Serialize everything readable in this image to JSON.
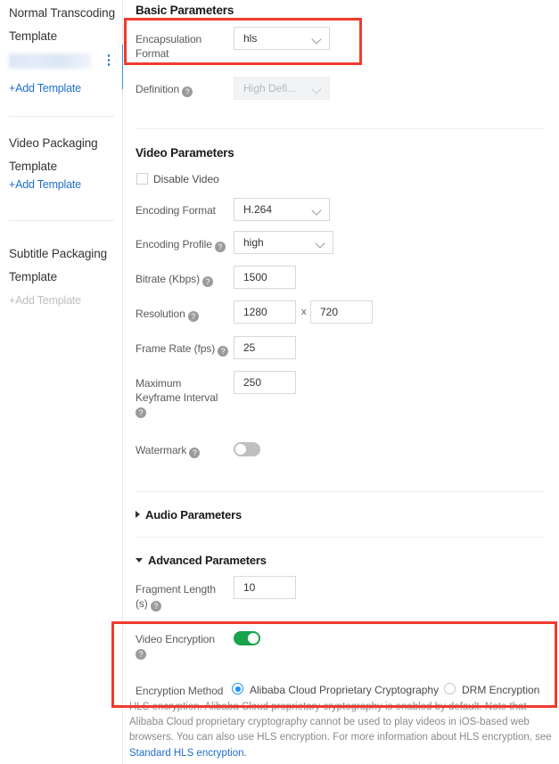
{
  "sidebar": {
    "sections": [
      {
        "title_line1": "Normal Transcoding",
        "title_line2": "Template",
        "add_label": "+Add Template",
        "add_disabled": false,
        "has_item": true,
        "item_redacted": true
      },
      {
        "title_line1": "Video Packaging",
        "title_line2": "Template",
        "add_label": "+Add Template",
        "add_disabled": false,
        "has_item": false,
        "item_redacted": false
      },
      {
        "title_line1": "Subtitle Packaging",
        "title_line2": "Template",
        "add_label": "+Add Template",
        "add_disabled": true,
        "has_item": false,
        "item_redacted": false
      }
    ]
  },
  "basic": {
    "section_title": "Basic Parameters",
    "encapsulation": {
      "label_line1": "Encapsulation",
      "label_line2": "Format",
      "value": "hls"
    },
    "definition": {
      "label": "Definition",
      "value": "High Defi...",
      "disabled": true
    }
  },
  "video": {
    "section_title": "Video Parameters",
    "disable_video": {
      "label": "Disable Video",
      "checked": false
    },
    "encoding_format": {
      "label": "Encoding Format",
      "value": "H.264"
    },
    "encoding_profile": {
      "label": "Encoding Profile",
      "value": "high"
    },
    "bitrate": {
      "label": "Bitrate (Kbps)",
      "value": "1500"
    },
    "resolution": {
      "label": "Resolution",
      "width": "1280",
      "separator": "x",
      "height": "720"
    },
    "frame_rate": {
      "label": "Frame Rate (fps)",
      "value": "25"
    },
    "keyframe": {
      "label_line1": "Maximum",
      "label_line2": "Keyframe Interval",
      "value": "250"
    },
    "watermark": {
      "label": "Watermark",
      "on": false
    }
  },
  "audio": {
    "section_title": "Audio Parameters",
    "expanded": false
  },
  "advanced": {
    "section_title": "Advanced Parameters",
    "expanded": true,
    "fragment_length": {
      "label_line1": "Fragment Length",
      "label_line2": "(s)",
      "value": "10"
    },
    "video_encryption": {
      "label": "Video Encryption",
      "on": true
    },
    "encryption_method": {
      "label": "Encryption Method",
      "options": [
        {
          "label": "Alibaba Cloud Proprietary Cryptography",
          "selected": true
        },
        {
          "label": "DRM Encryption",
          "selected": false
        }
      ]
    },
    "help_text": "HLS encryption. Alibaba Cloud proprietary cryptography is enabled by default. Note that Alibaba Cloud proprietary cryptography cannot be used to play videos in iOS-based web browsers. You can also use HLS encryption. For more information about HLS encryption, see ",
    "help_link": "Standard HLS encryption."
  },
  "icons": {
    "help": "?",
    "kebab": "vertical-dots"
  },
  "colors": {
    "accent_blue": "#1890ff",
    "link_blue": "#1f6fd0",
    "toggle_on_green": "#16a34a",
    "annotation_red": "#ef3b2d",
    "selection_blue": "#3a8ee6"
  }
}
